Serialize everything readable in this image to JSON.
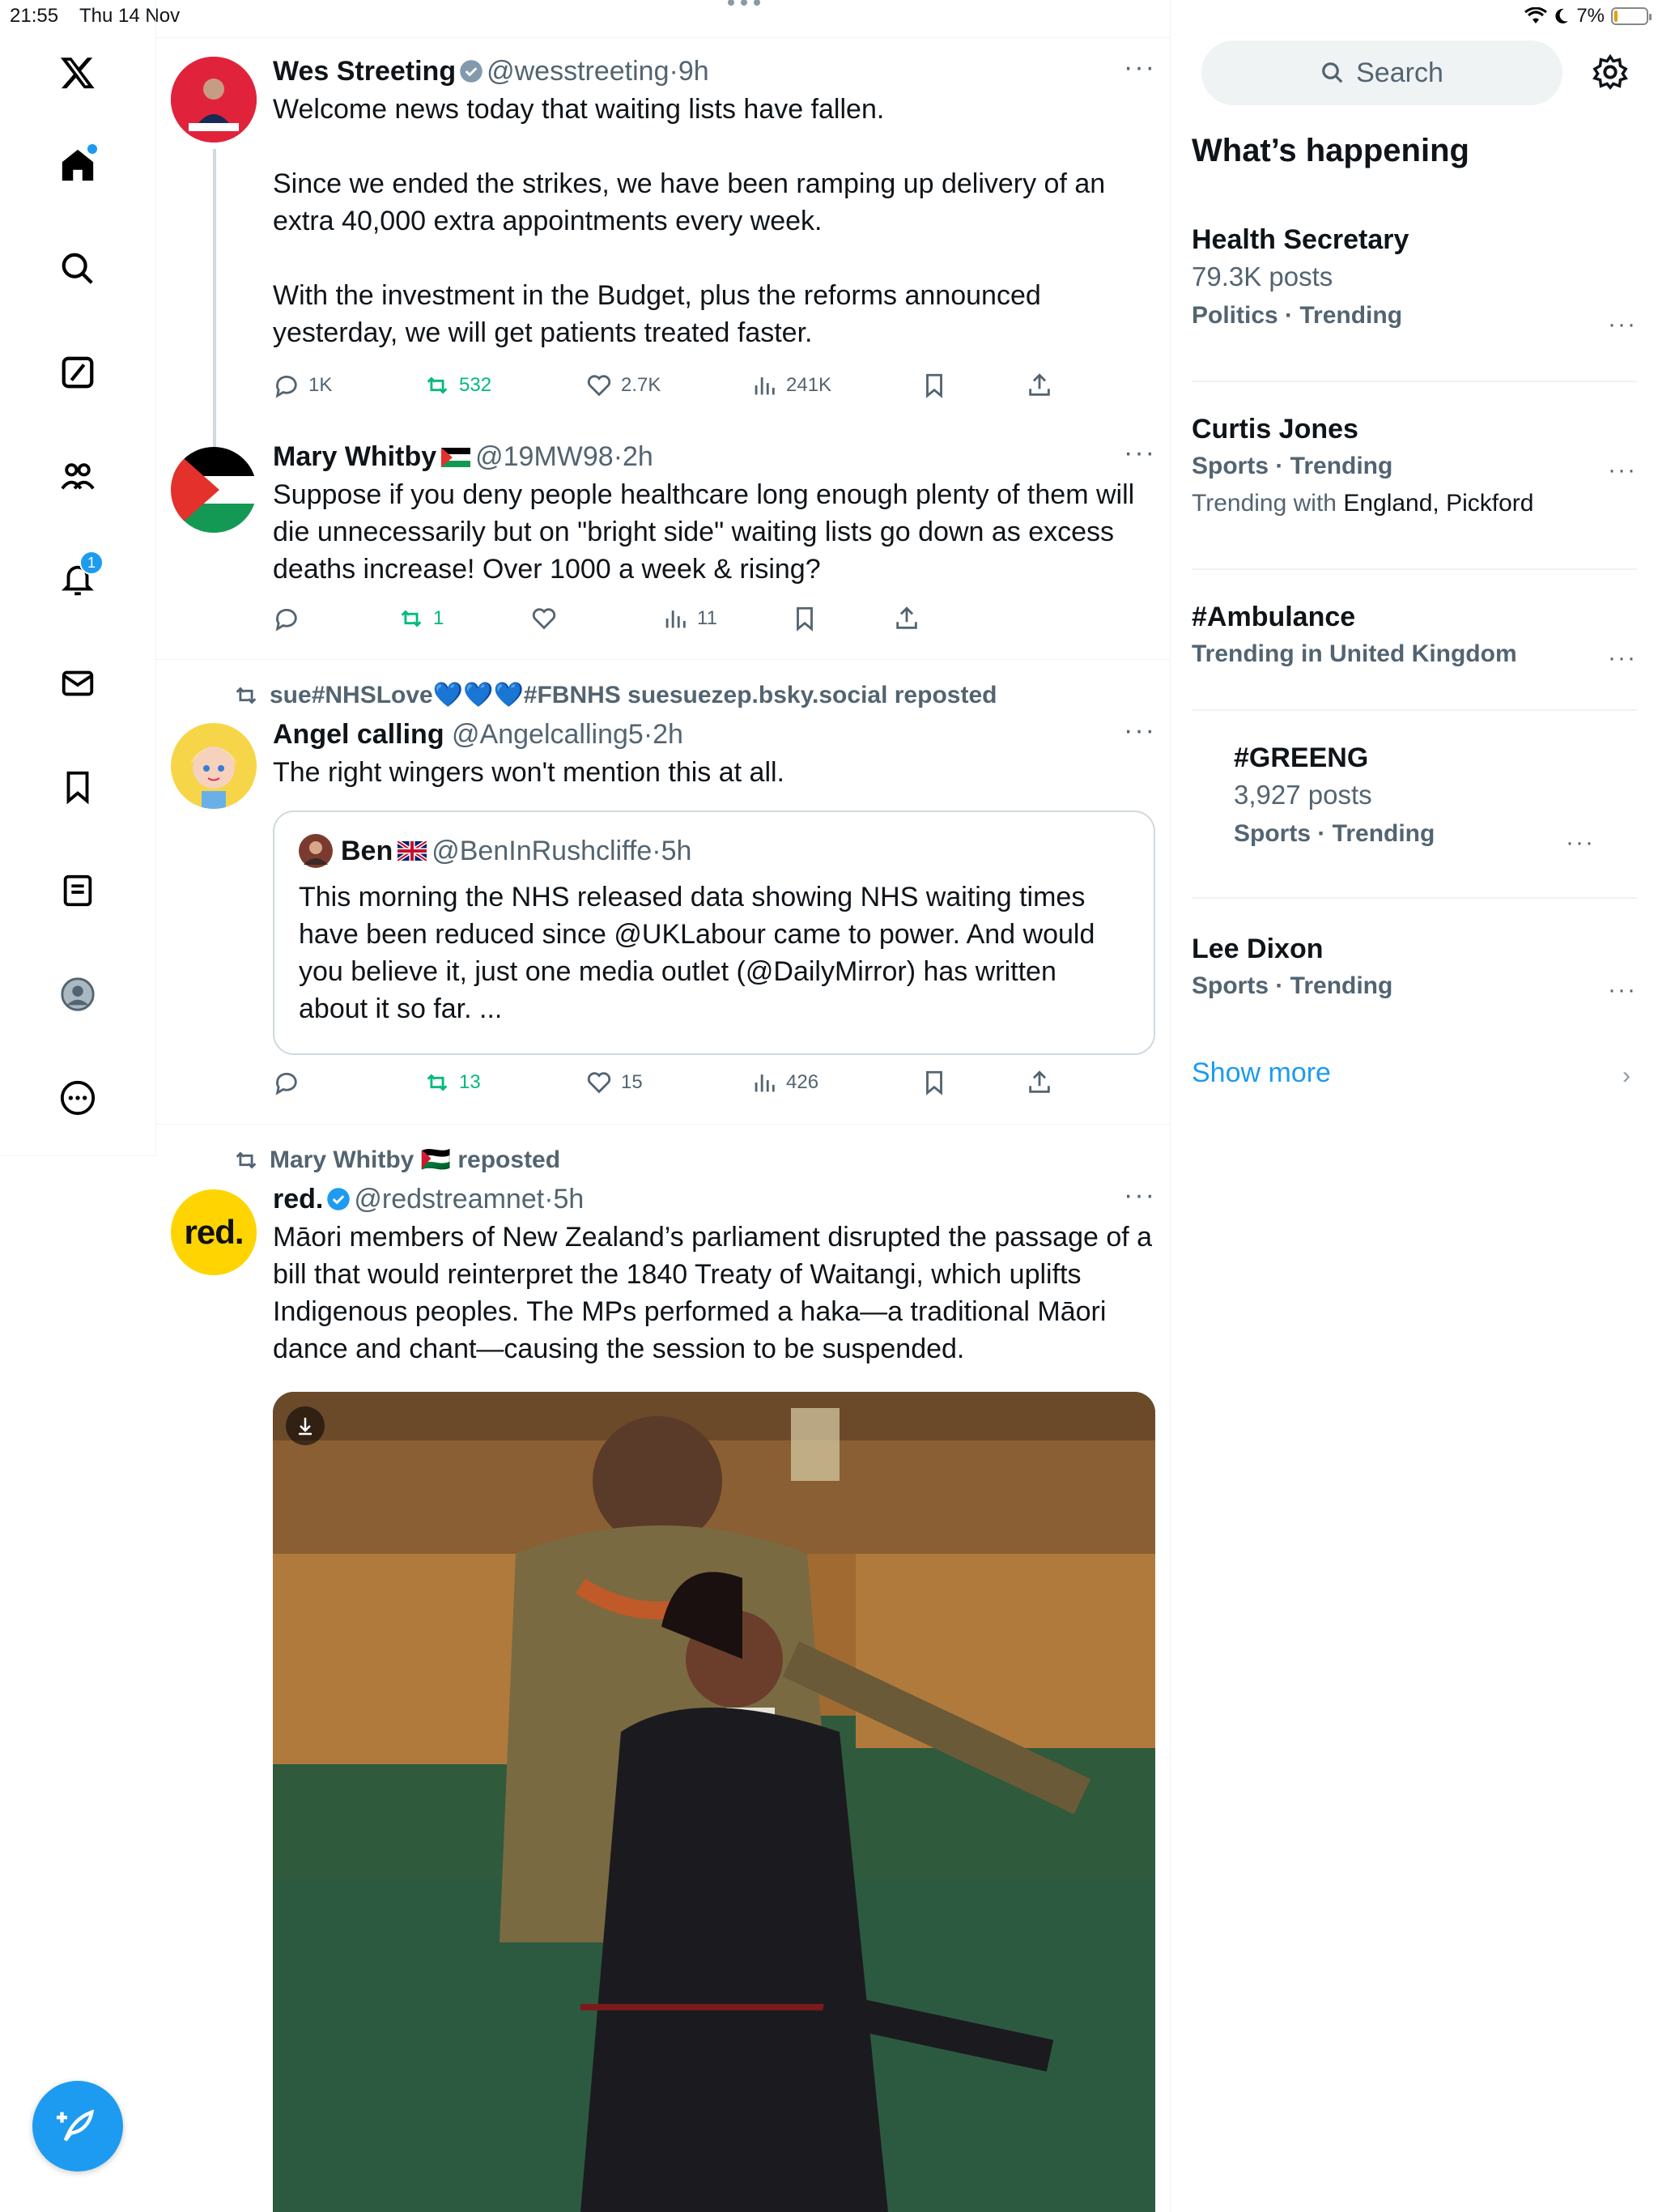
{
  "status_bar": {
    "time": "21:55",
    "date": "Thu 14 Nov",
    "battery": "7%"
  },
  "nav": {
    "items": [
      "X",
      "Home",
      "Search",
      "Grok",
      "Communities",
      "Notifications",
      "Messages",
      "Bookmarks",
      "Lists",
      "Profile",
      "More"
    ],
    "notifications_badge": "1"
  },
  "tweets": [
    {
      "name": "Wes Streeting",
      "handle": "@wesstreeting",
      "time": "·9h",
      "text": "Welcome news today that waiting lists have fallen.\n\nSince we ended the strikes, we have been ramping up delivery of an extra 40,000 extra appointments every week.\n\nWith the investment in the Budget, plus the reforms announced yesterday, we will get patients treated faster.",
      "replies": "1K",
      "reposts": "532",
      "likes": "2.7K",
      "views": "241K"
    },
    {
      "name": "Mary Whitby",
      "handle": "@19MW98",
      "time": "·2h",
      "text": "Suppose if you deny  people healthcare long enough plenty of them will die unnecessarily but on \"bright side\" waiting lists go down as excess deaths increase! Over 1000 a week & rising?",
      "replies": "",
      "reposts": "1",
      "likes": "",
      "views": "11"
    },
    {
      "social": "sue#NHSLove💙💙💙#FBNHS suesuezep.bsky.social reposted",
      "name": "Angel calling",
      "handle": "@Angelcalling5",
      "time": "·2h",
      "text": "The right wingers won't mention this at all.",
      "quote": {
        "name": "Ben",
        "handle": "@BenInRushcliffe",
        "time": "·5h",
        "text": "This morning the NHS released data showing NHS waiting times have been reduced since @UKLabour came to power. And would you believe it, just one media outlet (@DailyMirror) has written about it so far. ..."
      },
      "replies": "",
      "reposts": "13",
      "likes": "15",
      "views": "426"
    },
    {
      "social": "Mary Whitby 🇵🇸 reposted",
      "name": "red.",
      "handle": "@redstreamnet",
      "time": "·5h",
      "avatar_text": "red.",
      "text": "Māori members of New Zealand’s parliament disrupted the passage of a bill that would  reinterpret the 1840 Treaty of Waitangi, which uplifts Indigenous peoples. The MPs performed a haka—a traditional Māori dance and chant—causing the session to be suspended."
    }
  ],
  "sidebar": {
    "search_placeholder": "Search",
    "title": "What’s happening",
    "trends": [
      {
        "name": "Health Secretary",
        "posts": "79.3K posts",
        "meta": "Politics · Trending"
      },
      {
        "name": "Curtis Jones",
        "meta": "Sports · Trending",
        "with_label": "Trending with",
        "with_items": "England, Pickford"
      },
      {
        "name": "#Ambulance",
        "meta": "Trending in United Kingdom"
      },
      {
        "name": "#GREENG",
        "posts": "3,927 posts",
        "meta": "Sports · Trending"
      },
      {
        "name": "Lee Dixon",
        "meta": "Sports · Trending"
      }
    ],
    "show_more": "Show more"
  },
  "colors": {
    "accent": "#1d9bf0",
    "repost_green": "#00ba7c",
    "text": "#0f1419",
    "muted": "#536471"
  }
}
